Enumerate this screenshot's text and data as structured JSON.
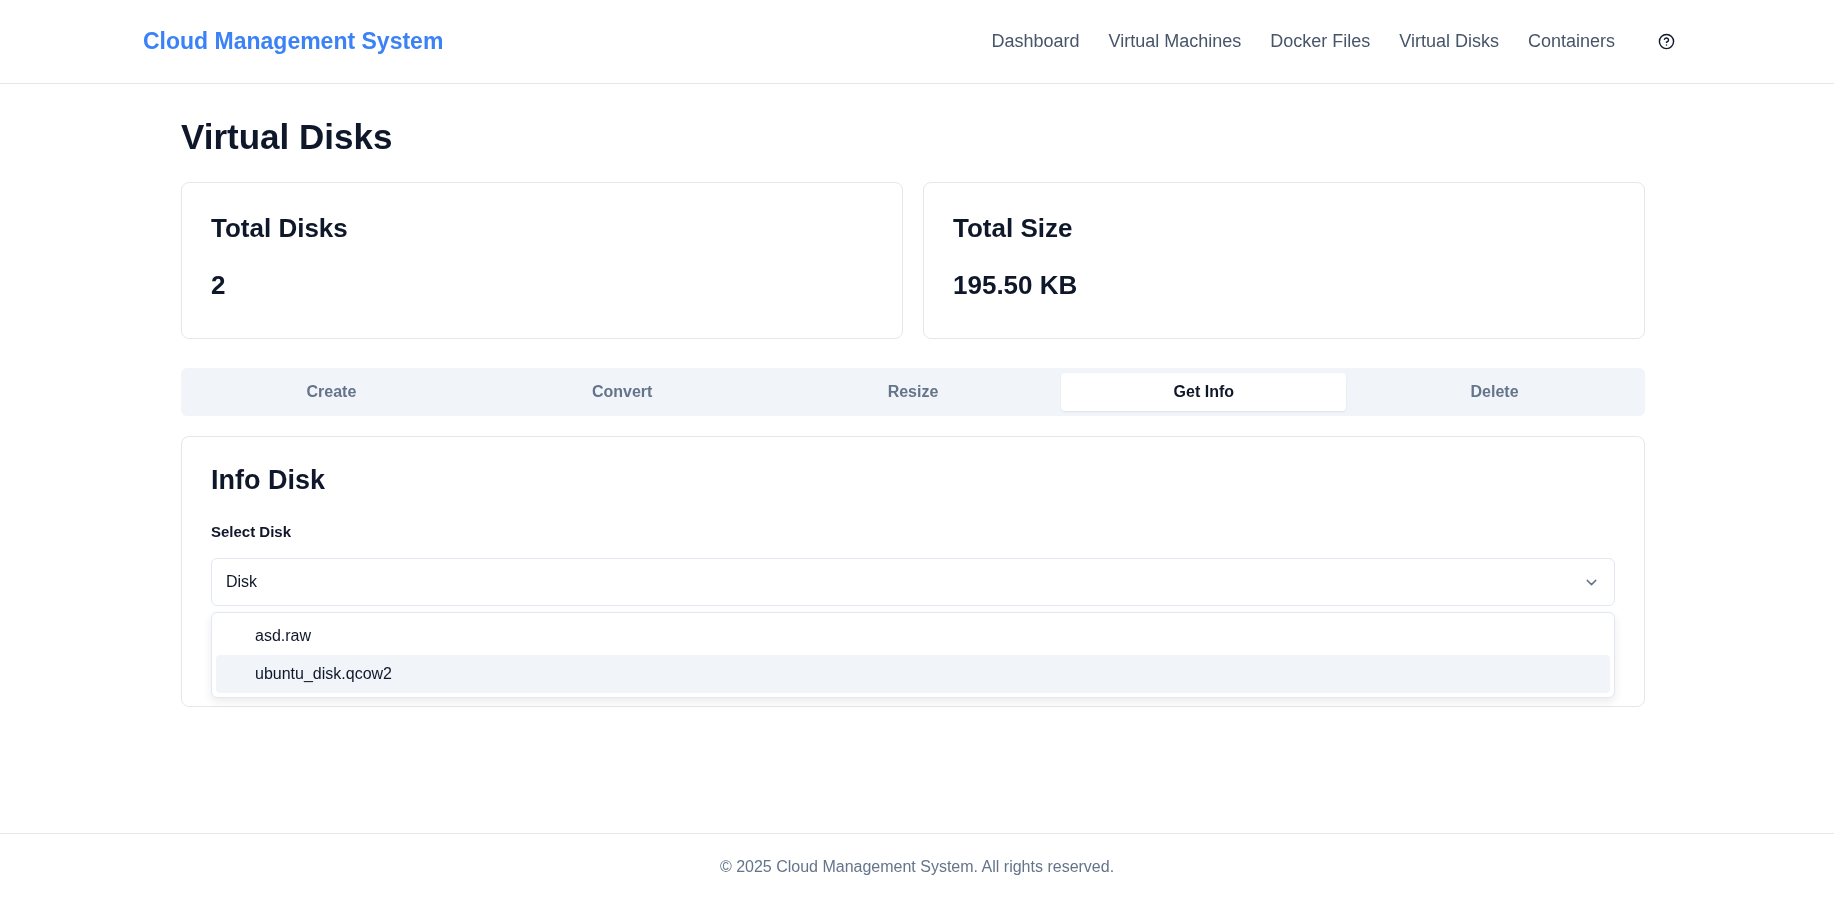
{
  "header": {
    "brand": "Cloud Management System",
    "nav": [
      {
        "label": "Dashboard",
        "selected": false
      },
      {
        "label": "Virtual Machines",
        "selected": false
      },
      {
        "label": "Docker Files",
        "selected": false
      },
      {
        "label": "Virtual Disks",
        "selected": false
      },
      {
        "label": "Containers",
        "selected": false
      }
    ]
  },
  "page_title": "Virtual Disks",
  "stats": [
    {
      "label": "Total Disks",
      "value": "2"
    },
    {
      "label": "Total Size",
      "value": "195.50 KB"
    }
  ],
  "tabs": [
    {
      "label": "Create",
      "selected": false
    },
    {
      "label": "Convert",
      "selected": false
    },
    {
      "label": "Resize",
      "selected": false
    },
    {
      "label": "Get Info",
      "selected": true
    },
    {
      "label": "Delete",
      "selected": false
    }
  ],
  "panel": {
    "title": "Info Disk",
    "field_label": "Select Disk",
    "select": {
      "placeholder": "Disk",
      "expanded": true,
      "options": [
        {
          "label": "asd.raw",
          "highlighted": false
        },
        {
          "label": "ubuntu_disk.qcow2",
          "highlighted": true
        }
      ]
    }
  },
  "footer": "© 2025 Cloud Management System. All rights reserved."
}
